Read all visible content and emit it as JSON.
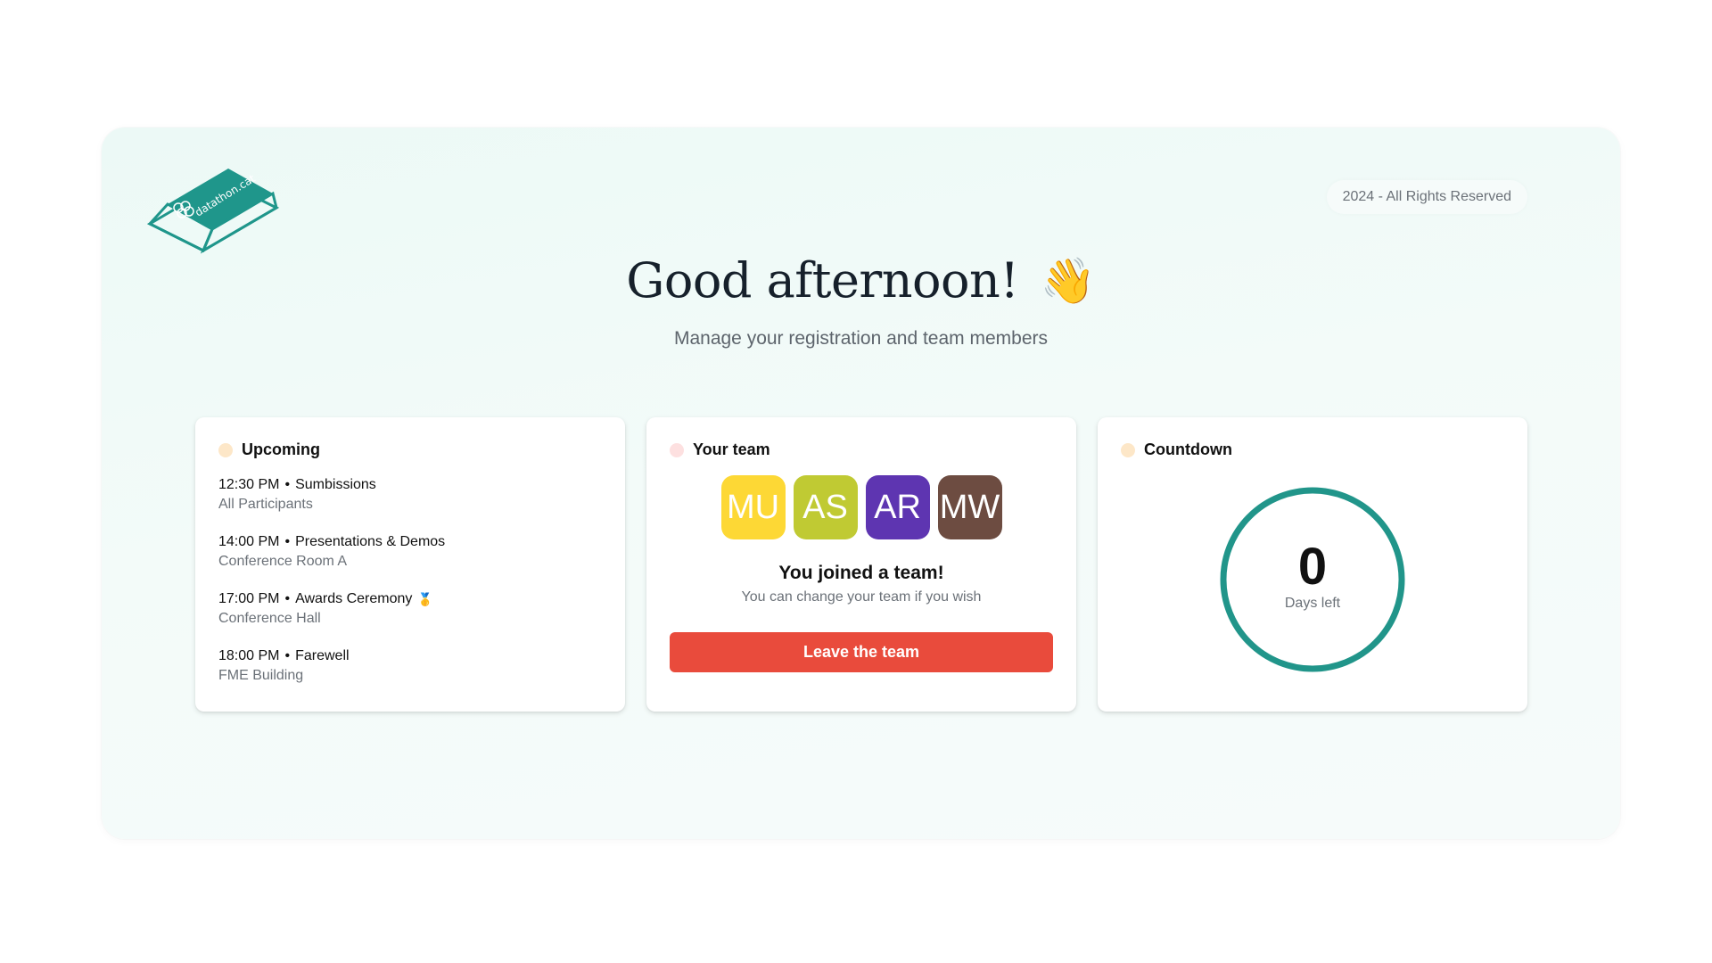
{
  "logo": {
    "text": "datathon.cat",
    "color": "#1f968b"
  },
  "copyright": "2024 - All Rights Reserved",
  "greeting": {
    "title": "Good afternoon!",
    "emoji": "👋"
  },
  "subtitle": "Manage your registration and team members",
  "upcoming": {
    "title": "Upcoming",
    "dot_color": "#fde7c8",
    "events": [
      {
        "time": "12:30 PM",
        "name": "Sumbissions",
        "location": "All Participants",
        "emoji": ""
      },
      {
        "time": "14:00 PM",
        "name": "Presentations & Demos",
        "location": "Conference Room A",
        "emoji": ""
      },
      {
        "time": "17:00 PM",
        "name": "Awards Ceremony",
        "location": "Conference Hall",
        "emoji": "🥇"
      },
      {
        "time": "18:00 PM",
        "name": "Farewell",
        "location": "FME Building",
        "emoji": ""
      }
    ]
  },
  "team": {
    "title": "Your team",
    "dot_color": "#fde0e0",
    "members": [
      {
        "initials": "MU",
        "color": "#fdd835"
      },
      {
        "initials": "AS",
        "color": "#c0ca33"
      },
      {
        "initials": "AR",
        "color": "#5e35b1"
      },
      {
        "initials": "MW",
        "color": "#6d4c41"
      }
    ],
    "joined_title": "You joined a team!",
    "joined_subtitle": "You can change your team if you wish",
    "leave_label": "Leave the team",
    "leave_color": "#e94b3c"
  },
  "countdown": {
    "title": "Countdown",
    "dot_color": "#fde7c8",
    "value": "0",
    "label": "Days left",
    "ring_color": "#21958a"
  }
}
